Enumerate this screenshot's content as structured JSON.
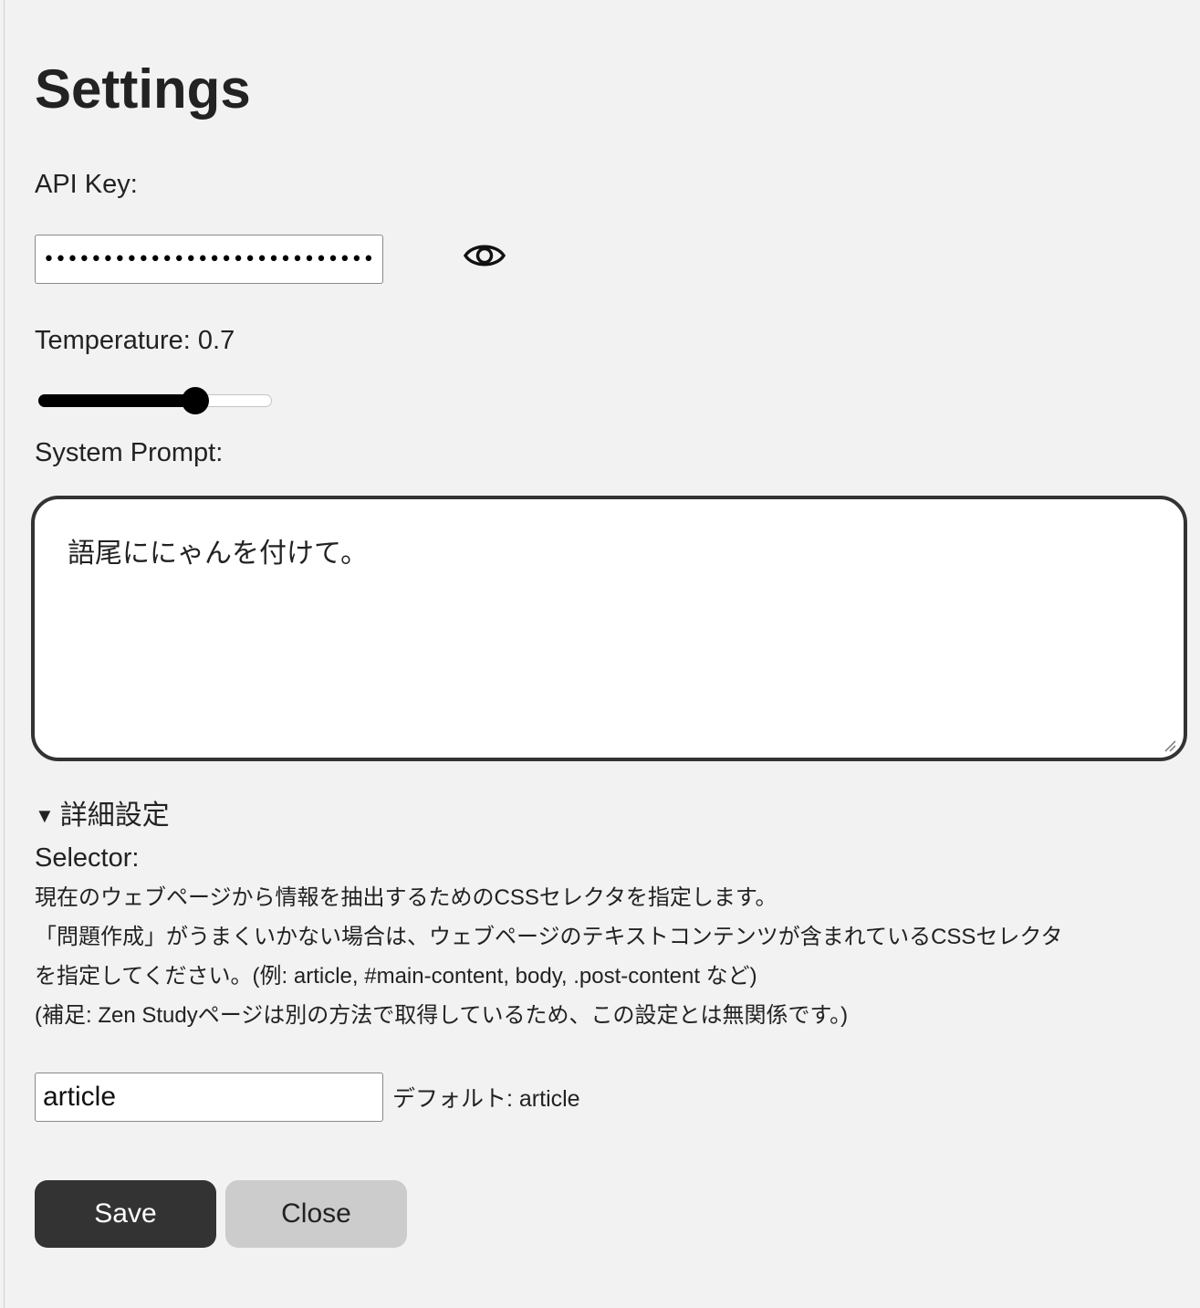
{
  "settings": {
    "title": "Settings",
    "api_key": {
      "label": "API Key:",
      "masked_value": "••••••••••••••••••••••••••••••••"
    },
    "visibility_toggle_icon": "eye-icon",
    "temperature": {
      "label": "Temperature: 0.7",
      "value": 0.7,
      "min": 0,
      "max": 1
    },
    "system_prompt": {
      "label": "System Prompt:",
      "value": "語尾ににゃんを付けて。"
    },
    "advanced": {
      "summary": "詳細設定",
      "expanded": true,
      "selector_label": "Selector:",
      "help_lines": [
        "現在のウェブページから情報を抽出するためのCSSセレクタを指定します。",
        "「問題作成」がうまくいかない場合は、ウェブページのテキストコンテンツが含まれているCSSセレクタ",
        "を指定してください。(例: article, #main-content, body, .post-content など)",
        "(補足: Zen Studyページは別の方法で取得しているため、この設定とは無関係です。)"
      ],
      "selector_value": "article",
      "default_note": "デフォルト: article"
    },
    "buttons": {
      "save": "Save",
      "close": "Close"
    },
    "colors": {
      "background": "#f2f2f2",
      "primary_button": "#333333",
      "secondary_button": "#cccccc",
      "text": "#222222"
    }
  }
}
